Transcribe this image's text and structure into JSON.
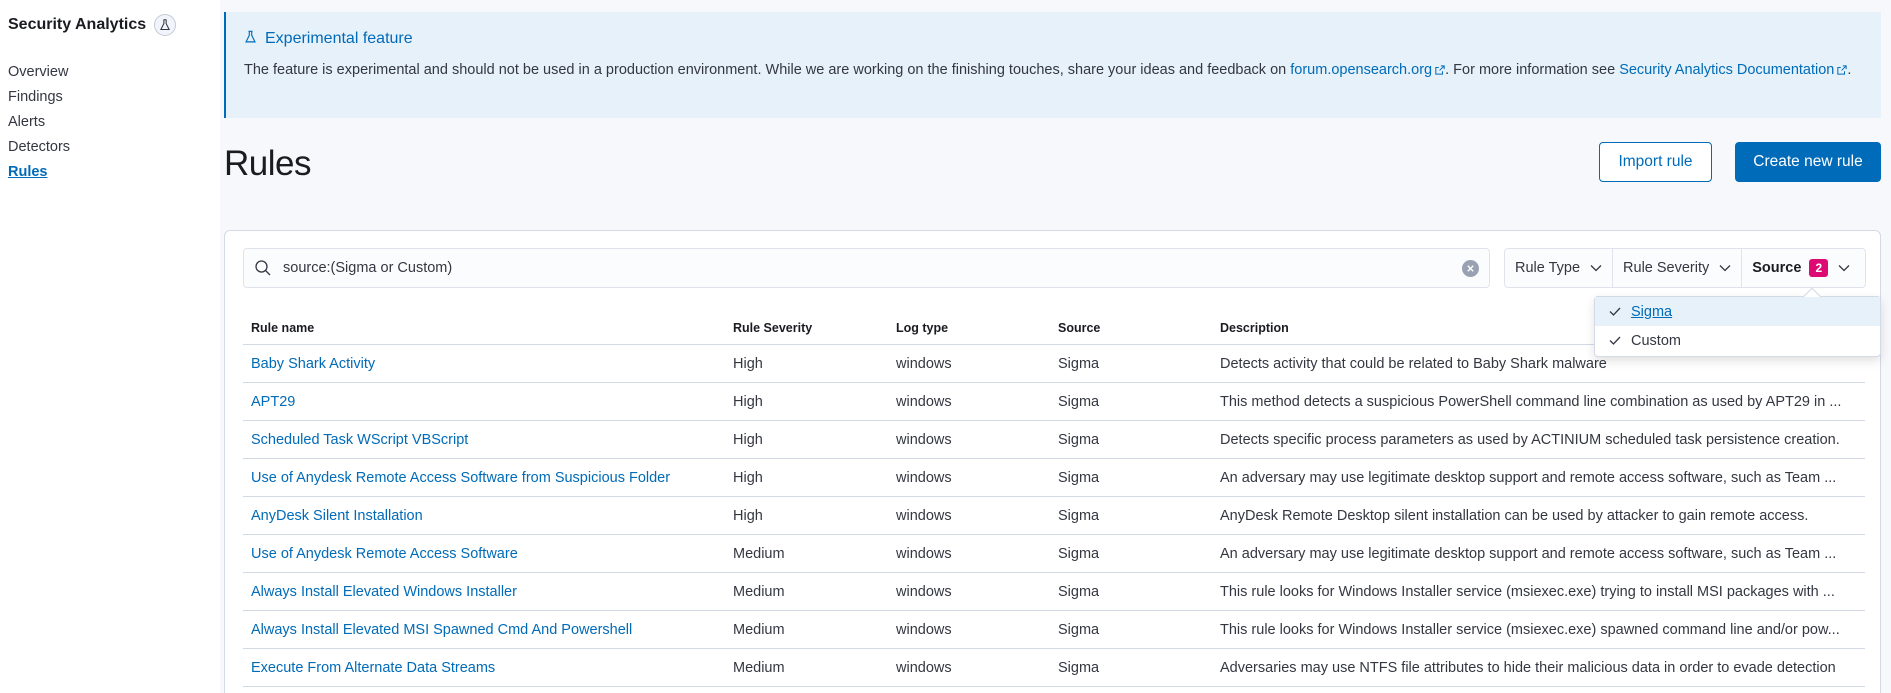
{
  "sidebar": {
    "title": "Security Analytics",
    "items": [
      {
        "label": "Overview"
      },
      {
        "label": "Findings"
      },
      {
        "label": "Alerts"
      },
      {
        "label": "Detectors"
      },
      {
        "label": "Rules"
      }
    ],
    "active": "Rules"
  },
  "callout": {
    "title": "Experimental feature",
    "text_before": "The feature is experimental and should not be used in a production environment. While we are working on the finishing touches, share your ideas and feedback on ",
    "forum_link": "forum.opensearch.org",
    "text_middle": ". For more information see ",
    "docs_link": "Security Analytics Documentation",
    "text_after": "."
  },
  "page": {
    "title": "Rules",
    "import_button": "Import rule",
    "create_button": "Create new rule"
  },
  "search": {
    "value": "source:(Sigma or Custom)"
  },
  "filters": {
    "rule_type": "Rule Type",
    "rule_severity": "Rule Severity",
    "source": "Source",
    "source_count": "2"
  },
  "source_dropdown": {
    "options": [
      {
        "label": "Sigma",
        "checked": true
      },
      {
        "label": "Custom",
        "checked": true
      }
    ]
  },
  "table": {
    "columns": [
      "Rule name",
      "Rule Severity",
      "Log type",
      "Source",
      "Description"
    ],
    "rows": [
      {
        "name": "Baby Shark Activity",
        "severity": "High",
        "log_type": "windows",
        "source": "Sigma",
        "description": "Detects activity that could be related to Baby Shark malware"
      },
      {
        "name": "APT29",
        "severity": "High",
        "log_type": "windows",
        "source": "Sigma",
        "description": "This method detects a suspicious PowerShell command line combination as used by APT29 in ..."
      },
      {
        "name": "Scheduled Task WScript VBScript",
        "severity": "High",
        "log_type": "windows",
        "source": "Sigma",
        "description": "Detects specific process parameters as used by ACTINIUM scheduled task persistence creation."
      },
      {
        "name": "Use of Anydesk Remote Access Software from Suspicious Folder",
        "severity": "High",
        "log_type": "windows",
        "source": "Sigma",
        "description": "An adversary may use legitimate desktop support and remote access software, such as Team ..."
      },
      {
        "name": "AnyDesk Silent Installation",
        "severity": "High",
        "log_type": "windows",
        "source": "Sigma",
        "description": "AnyDesk Remote Desktop silent installation can be used by attacker to gain remote access."
      },
      {
        "name": "Use of Anydesk Remote Access Software",
        "severity": "Medium",
        "log_type": "windows",
        "source": "Sigma",
        "description": "An adversary may use legitimate desktop support and remote access software, such as Team ..."
      },
      {
        "name": "Always Install Elevated Windows Installer",
        "severity": "Medium",
        "log_type": "windows",
        "source": "Sigma",
        "description": "This rule looks for Windows Installer service (msiexec.exe) trying to install MSI packages with ..."
      },
      {
        "name": "Always Install Elevated MSI Spawned Cmd And Powershell",
        "severity": "Medium",
        "log_type": "windows",
        "source": "Sigma",
        "description": "This rule looks for Windows Installer service (msiexec.exe) spawned command line and/or pow..."
      },
      {
        "name": "Execute From Alternate Data Streams",
        "severity": "Medium",
        "log_type": "windows",
        "source": "Sigma",
        "description": "Adversaries may use NTFS file attributes to hide their malicious data in order to evade detection"
      }
    ]
  },
  "colors": {
    "primary": "#006bb8",
    "badge": "#dd0a73",
    "callout_bg": "#e6f1fa"
  },
  "icons": {
    "beaker": "flask-icon",
    "search": "search-icon",
    "clear": "clear-icon",
    "chevron": "chevron-down-icon",
    "check": "check-icon",
    "external": "external-link-icon"
  }
}
